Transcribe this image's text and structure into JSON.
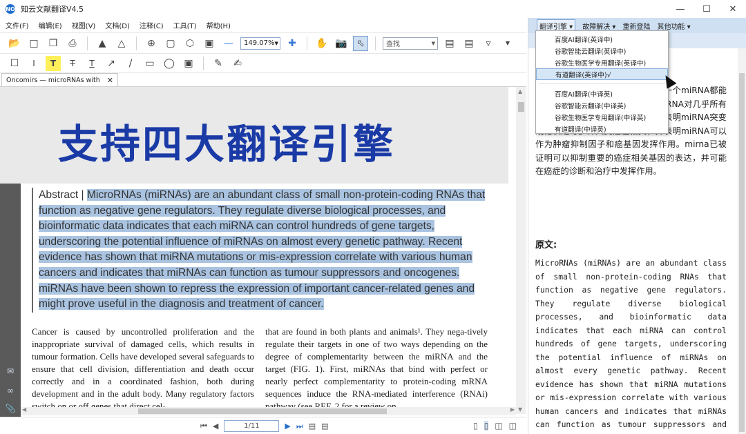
{
  "window": {
    "logo": "NO",
    "title": "知云文献翻译V4.5",
    "controls": {
      "minimize": "—",
      "maximize": "☐",
      "close": "✕"
    }
  },
  "menu": [
    "文件(F)",
    "编辑(E)",
    "视图(V)",
    "文档(D)",
    "注释(C)",
    "工具(T)",
    "帮助(H)"
  ],
  "toolbar": {
    "zoom_value": "149.07%",
    "search_value": "查找"
  },
  "tab": {
    "label": "Oncomirs — microRNAs with",
    "close": "✕"
  },
  "banner": {
    "text": "支持四大翻译引擎"
  },
  "abstract": {
    "label": "Abstract |",
    "text": "MicroRNAs (miRNAs) are an abundant class of small non-protein-coding RNAs that function as negative gene regulators. They regulate diverse biological processes, and bioinformatic data indicates that each miRNA can control hundreds of gene targets, underscoring the potential influence of miRNAs on almost every genetic pathway. Recent evidence has shown that miRNA mutations or mis-expression correlate with various human cancers and indicates that miRNAs can function as tumour suppressors and oncogenes. miRNAs have been shown to repress the expression of important cancer-related genes and might prove useful in the diagnosis and treatment of cancer."
  },
  "body": {
    "col1": "Cancer is caused by uncontrolled proliferation and the inappropriate survival of damaged cells, which results in tumour formation. Cells have developed several safeguards to ensure that cell division, differentiation and death occur correctly and in a coordinated fashion, both during development and in the adult body. Many regulatory factors switch on or off genes that direct cel-",
    "col2": "that are found in both plants and animals¹. They nega-tively regulate their targets in one of two ways depending on the degree of complementarity between the miRNA and the target (FIG. 1). First, miRNAs that bind with perfect or nearly perfect complementarity to protein-coding mRNA sequences induce the RNA-mediated interference (RNAi) pathway (see REF. 2 for a review on"
  },
  "statusbar": {
    "page": "1/11"
  },
  "right_panel": {
    "menu": [
      "翻译引擎 ▾",
      "故障解决 ▾",
      "重新登陆",
      "其他功能 ▾"
    ],
    "translation": "富的非蛋白编它们调节不同的，每一个miRNA都能控制数百个基因靶点，这凸显了miRNA对几乎所有遗传通路的潜在影响。最近的证据表明miRNA突变或错表达与多种人类癌症相关，并表明miRNA可以作为肿瘤抑制因子和癌基因发挥作用。mirna已被证明可以抑制重要的癌症相关基因的表达，并可能在癌症的诊断和治疗中发挥作用。",
    "heading": "原文:",
    "original": "MicroRNAs (miRNAs) are an abundant class of small non-protein-coding RNAs that function as negative gene regulators. They regulate diverse biological processes, and bioinformatic data indicates that each miRNA can control hundreds of gene targets, underscoring the potential influence of miRNAs on almost every genetic pathway. Recent evidence has shown that miRNA mutations or mis-expression correlate with various human cancers and indicates that miRNAs can function as tumour suppressors and oncogenes. miRNAs have been shown to"
  },
  "dropdown": {
    "group1": [
      "百度AI翻译(英译中)",
      "谷歌智能云翻译(英译中)",
      "谷歌生物医学专用翻译(英译中)",
      "有道翻译(英译中)√"
    ],
    "group2": [
      "百度AI翻译(中译英)",
      "谷歌智能云翻译(中译英)",
      "谷歌生物医学专用翻译(中译英)",
      "有道翻译(中译英)"
    ]
  }
}
